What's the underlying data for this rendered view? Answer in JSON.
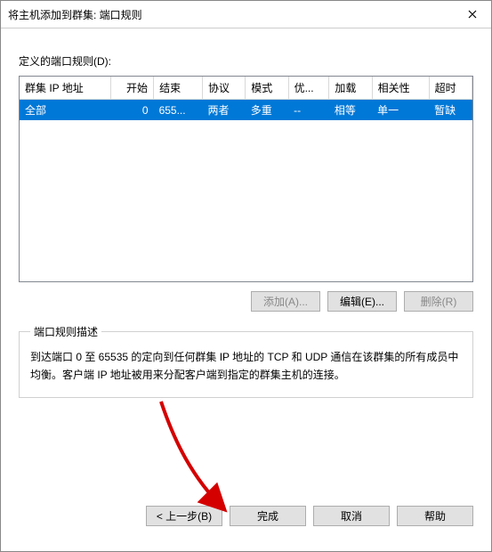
{
  "titlebar": {
    "title": "将主机添加到群集: 端口规则"
  },
  "section_label": "定义的端口规则(D):",
  "table": {
    "headers": [
      "群集 IP 地址",
      "开始",
      "结束",
      "协议",
      "模式",
      "优...",
      "加载",
      "相关性",
      "超时"
    ],
    "rows": [
      {
        "cells": [
          "全部",
          "0",
          "655...",
          "两者",
          "多重",
          "--",
          "相等",
          "单一",
          "暂缺"
        ],
        "selected": true
      }
    ]
  },
  "row_buttons": {
    "add": {
      "label": "添加(A)...",
      "enabled": false
    },
    "edit": {
      "label": "编辑(E)...",
      "enabled": true
    },
    "remove": {
      "label": "删除(R)",
      "enabled": false
    }
  },
  "rule_desc": {
    "legend": "端口规则描述",
    "text": "到达端口 0 至 65535 的定向到任何群集 IP 地址的 TCP 和 UDP 通信在该群集的所有成员中均衡。客户端 IP 地址被用来分配客户端到指定的群集主机的连接。"
  },
  "footer": {
    "back": "< 上一步(B)",
    "finish": "完成",
    "cancel": "取消",
    "help": "帮助"
  }
}
